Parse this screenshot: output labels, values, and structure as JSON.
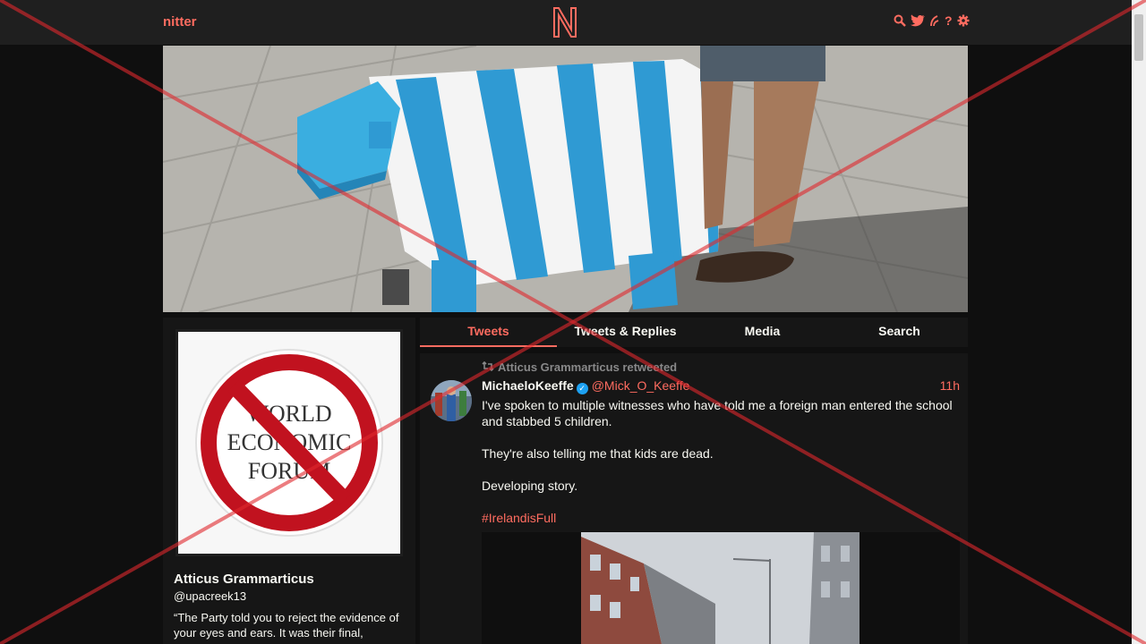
{
  "navbar": {
    "brand": "nitter",
    "logo_letter": "N",
    "icons": [
      "search-icon",
      "bird-icon",
      "rss-icon",
      "help-icon",
      "gear-icon"
    ]
  },
  "colors": {
    "accent": "#ff6c60",
    "background": "#0f0f0f",
    "panel": "#161616",
    "navbar": "#1f1f1f",
    "text": "#f8f8f2",
    "muted": "#888889"
  },
  "profile": {
    "fullname": "Atticus Grammarticus",
    "username": "@upacreek13",
    "bio": "“The Party told you to reject the evidence of your eyes and ears. It was their final,",
    "avatar_text": [
      "WORLD",
      "ECONOMIC",
      "FORUM"
    ]
  },
  "tabs": [
    {
      "label": "Tweets",
      "active": true
    },
    {
      "label": "Tweets & Replies",
      "active": false
    },
    {
      "label": "Media",
      "active": false
    },
    {
      "label": "Search",
      "active": false
    }
  ],
  "tweet": {
    "retweet_header": "Atticus Grammarticus retweeted",
    "fullname": "MichaeloKeeffe",
    "verified": true,
    "username": "@Mick_O_Keeffe",
    "date": "11h",
    "paragraphs": [
      "I've spoken to multiple witnesses who have told me a foreign man entered the school and stabbed 5 children.",
      "They're also telling me that kids are dead.",
      "Developing story."
    ],
    "hashtag": "#IrelandisFull"
  }
}
